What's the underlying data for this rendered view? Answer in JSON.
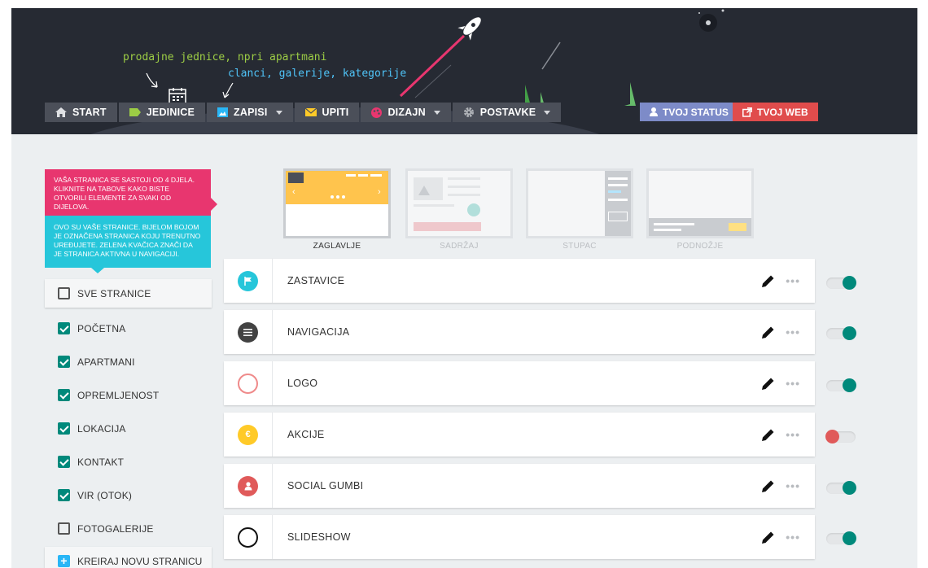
{
  "header": {
    "hint_units": "prodajne jednice, npri apartmani",
    "hint_posts": "clanci, galerije, kategorije",
    "nav": [
      {
        "id": "start",
        "label": "START",
        "icon": "home-icon",
        "color": "#dfe1e4",
        "dropdown": false
      },
      {
        "id": "jedinice",
        "label": "JEDINICE",
        "icon": "tag-icon",
        "color": "#9ccc45",
        "dropdown": false
      },
      {
        "id": "zapisi",
        "label": "ZAPISI",
        "icon": "image-icon",
        "color": "#29b6f6",
        "dropdown": true
      },
      {
        "id": "upiti",
        "label": "UPITI",
        "icon": "mail-icon",
        "color": "#ffca28",
        "dropdown": false
      },
      {
        "id": "dizajn",
        "label": "DIZAJN",
        "icon": "palette-icon",
        "color": "#e8366f",
        "dropdown": true
      },
      {
        "id": "postavke",
        "label": "POSTAVKE",
        "icon": "gear-icon",
        "color": "#b0b3b8",
        "dropdown": true
      }
    ],
    "status_label": "TVOJ STATUS",
    "web_label": "TVOJ WEB"
  },
  "sidebar": {
    "info_pink": "Vaša stranica se sastoji od 4 djela. Kliknite na tabove kako biste otvorili elemente za svaki od dijelova.",
    "info_cyan": "Ovo su vaše stranice. Bijelom bojom je označena stranica koju trenutno uređujete. Zelena kvačica znači da je stranica aktivna u navigaciji.",
    "all_pages": "SVE STRANICE",
    "pages": [
      {
        "label": "POČETNA",
        "checked": true
      },
      {
        "label": "APARTMANI",
        "checked": true
      },
      {
        "label": "OPREMLJENOST",
        "checked": true
      },
      {
        "label": "LOKACIJA",
        "checked": true
      },
      {
        "label": "KONTAKT",
        "checked": true
      },
      {
        "label": "VIR (OTOK)",
        "checked": true
      },
      {
        "label": "FOTOGALERIJE",
        "checked": false
      }
    ],
    "create_page": "KREIRAJ NOVU STRANICU"
  },
  "layout_tabs": [
    {
      "label": "ZAGLAVLJE",
      "active": true
    },
    {
      "label": "SADRŽAJ",
      "active": false
    },
    {
      "label": "STUPAC",
      "active": false
    },
    {
      "label": "PODNOŽJE",
      "active": false
    }
  ],
  "sections": [
    {
      "title": "ZASTAVICE",
      "icon": "flag-icon",
      "color": "#26c6da",
      "style": "filled",
      "enabled": true
    },
    {
      "title": "NAVIGACIJA",
      "icon": "menu-icon",
      "color": "#424242",
      "style": "filled",
      "enabled": true
    },
    {
      "title": "LOGO",
      "icon": "circle-icon",
      "color": "#ef8a8a",
      "style": "outline",
      "enabled": true
    },
    {
      "title": "AKCIJE",
      "icon": "euro-icon",
      "color": "#ffca28",
      "style": "filled",
      "enabled": false
    },
    {
      "title": "SOCIAL GUMBI",
      "icon": "person-icon",
      "color": "#e05a5a",
      "style": "filled",
      "enabled": true
    },
    {
      "title": "SLIDESHOW",
      "icon": "circle-icon",
      "color": "#111111",
      "style": "outline",
      "enabled": true
    }
  ],
  "colors": {
    "toggle_on": "#00897b",
    "toggle_off": "#e05a5a",
    "header_bg": "#262a33"
  }
}
